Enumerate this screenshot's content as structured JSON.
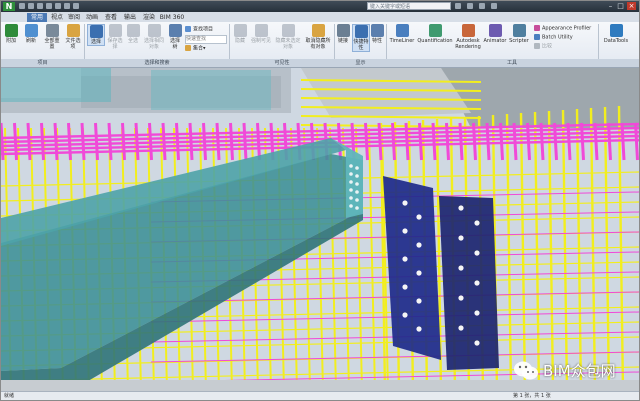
{
  "titlebar": {
    "app_logo": "N",
    "search_placeholder": "键入关键字或短语"
  },
  "tabs": [
    "常用",
    "视点",
    "审阅",
    "动画",
    "查看",
    "输出",
    "渲染",
    "BIM 360"
  ],
  "active_tab": "常用",
  "ribbon": {
    "project": [
      {
        "label": "附加",
        "icon": "append-icon",
        "dim": false
      },
      {
        "label": "刷新",
        "icon": "refresh-icon",
        "dim": false
      },
      {
        "label": "全部重置",
        "icon": "reset-all-icon",
        "dim": false
      },
      {
        "label": "文件选项",
        "icon": "file-options-icon",
        "dim": false
      }
    ],
    "select_search": [
      {
        "label": "选择",
        "icon": "select-icon",
        "dim": false
      },
      {
        "label": "保存选择",
        "icon": "save-selection-icon",
        "dim": true
      },
      {
        "label": "全选",
        "icon": "select-all-icon",
        "dim": true
      },
      {
        "label": "选择相同对象",
        "icon": "select-same-icon",
        "dim": true
      },
      {
        "label": "选择树",
        "icon": "selection-tree-icon",
        "dim": false
      }
    ],
    "select_small": {
      "find_items": "查找项目",
      "quick_find": "快速查找",
      "sets": "集合"
    },
    "visibility": [
      {
        "label": "隐藏",
        "icon": "hide-icon",
        "dim": true
      },
      {
        "label": "强制可见",
        "icon": "require-icon",
        "dim": true
      },
      {
        "label": "隐藏未选定对象",
        "icon": "hide-unselected-icon",
        "dim": true
      },
      {
        "label": "取消隐藏所有对象",
        "icon": "unhide-all-icon",
        "dim": false
      }
    ],
    "display": [
      {
        "label": "链接",
        "icon": "links-icon",
        "dim": false
      },
      {
        "label": "快捷特性",
        "icon": "quick-properties-icon",
        "dim": false
      },
      {
        "label": "特性",
        "icon": "properties-icon",
        "dim": false
      }
    ],
    "tools": [
      {
        "label": "TimeLiner",
        "icon": "timeliner-icon",
        "dim": false
      },
      {
        "label": "Quantification",
        "icon": "quantification-icon",
        "dim": false
      },
      {
        "label": "Autodesk Rendering",
        "icon": "rendering-icon",
        "dim": false
      },
      {
        "label": "Animator",
        "icon": "animator-icon",
        "dim": false
      },
      {
        "label": "Scripter",
        "icon": "scripter-icon",
        "dim": false
      }
    ],
    "tools_small": [
      "Appearance Profiler",
      "Batch Utility",
      "比较"
    ],
    "datatools": {
      "label": "DataTools",
      "icon": "datatools-icon"
    }
  },
  "panel_labels": {
    "project": "项目",
    "select_search": "选择和搜索",
    "visibility": "可见性",
    "display": "显示",
    "tools": "工具"
  },
  "status": {
    "left": "就绪",
    "page": "第 1 张，共 1 张"
  },
  "watermark": "BIM众包网",
  "colors": {
    "rebar_yellow": "#f2ee1e",
    "rebar_magenta": "#f04ad8",
    "steel_beam": "#3d8f96",
    "plate_blue": "#1e2a8a",
    "sky": "#cdd6e1",
    "active_tab": "#4a79b5"
  }
}
